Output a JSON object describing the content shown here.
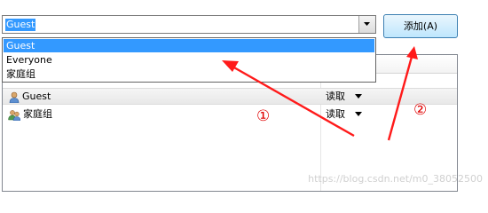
{
  "combo": {
    "value": "Guest"
  },
  "add_button": {
    "label": "添加(A)"
  },
  "dropdown": {
    "options": [
      "Guest",
      "Everyone",
      "家庭组"
    ],
    "selected": "Guest"
  },
  "rows": [
    {
      "name": "Guest",
      "permission": "读取"
    },
    {
      "name": "家庭组",
      "permission": "读取"
    }
  ],
  "annotations": {
    "marker1": "①",
    "marker2": "②",
    "color": "#ff0000"
  },
  "watermark": "https://blog.csdn.net/m0_38052500"
}
